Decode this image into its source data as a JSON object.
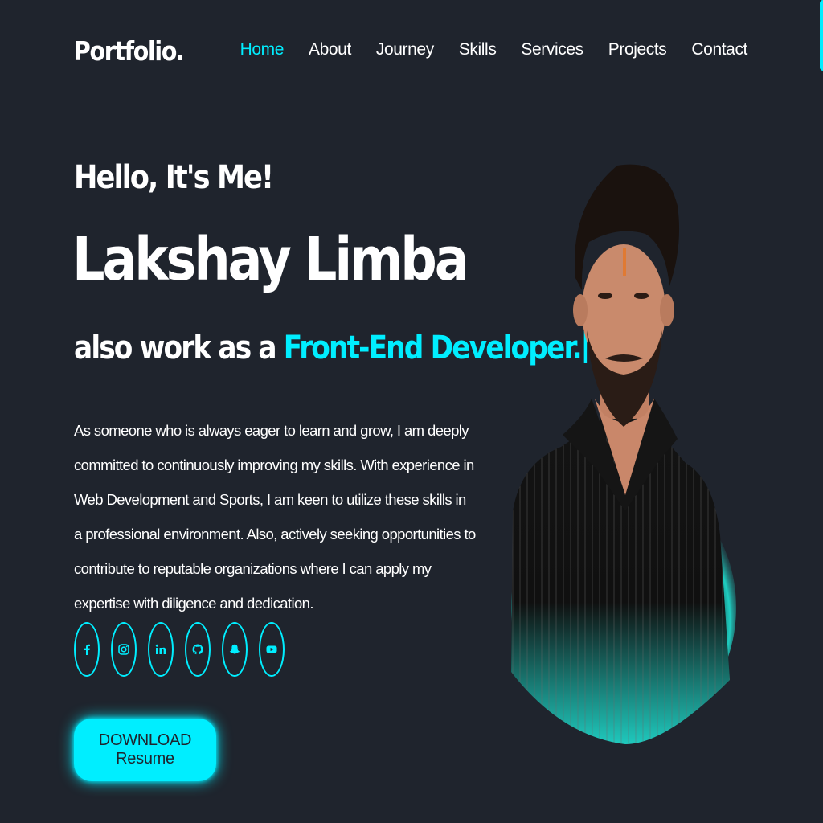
{
  "header": {
    "logo": "Portfolio.",
    "nav": [
      "Home",
      "About",
      "Journey",
      "Skills",
      "Services",
      "Projects",
      "Contact"
    ],
    "active_nav": "Home"
  },
  "hero": {
    "greeting": "Hello, It's Me!",
    "name": "Lakshay Limba",
    "role_prefix": "also work as a",
    "role_highlight": "Front-End Developer.",
    "description": "As someone who is always eager to learn and grow, I am deeply committed to continuously improving my skills. With experience in Web Development and Sports, I am keen to utilize these skills in a professional environment. Also, actively seeking opportunities to contribute to reputable organizations where I can apply my expertise with diligence and dedication.",
    "socials": [
      "facebook-icon",
      "instagram-icon",
      "linkedin-icon",
      "github-icon",
      "snapchat-icon",
      "youtube-icon"
    ],
    "button": "DOWNLOAD Resume"
  },
  "colors": {
    "background": "#1f242d",
    "accent": "#00eeff",
    "text": "#ffffff"
  }
}
